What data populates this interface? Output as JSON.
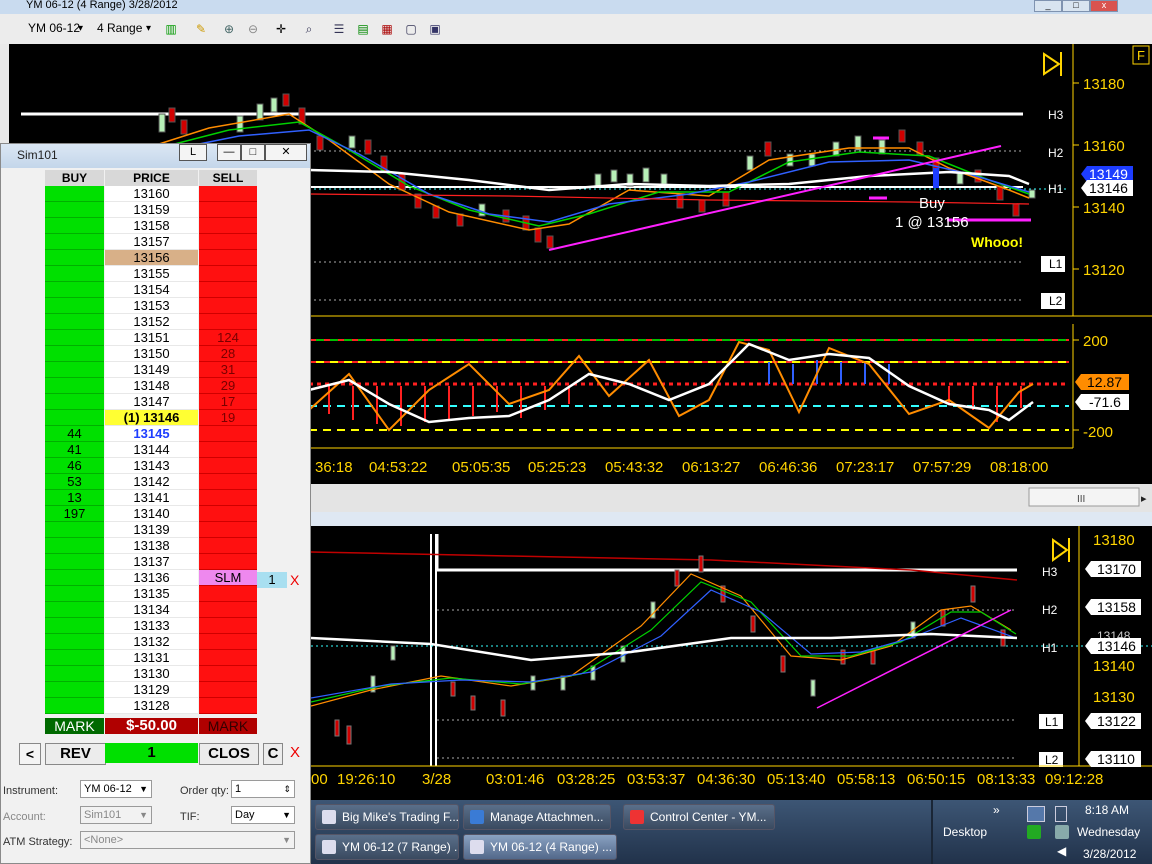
{
  "window": {
    "title": "YM 06-12 (4 Range)  3/28/2012"
  },
  "toolbar": {
    "instrument": "YM 06-12",
    "range": "4 Range"
  },
  "chart1": {
    "prices": [
      "13180",
      "13160",
      "13140",
      "13120"
    ],
    "tags": [
      "H3",
      "H2",
      "H1",
      "L1",
      "L2"
    ],
    "price_marker_a": "13149",
    "price_marker_b": "13146",
    "fill_text_1": "Buy",
    "fill_text_2": "1 @ 13156",
    "note": "Whooo!",
    "f_button": "F",
    "osc_values": [
      "200",
      "-200"
    ],
    "osc_marker_a": "12.87",
    "osc_marker_b": "-71.6",
    "times": [
      "36:18",
      "04:53:22",
      "05:05:35",
      "05:25:23",
      "05:43:32",
      "06:13:27",
      "06:46:36",
      "07:23:17",
      "07:57:29",
      "08:18:00"
    ],
    "scroll_grip": "III"
  },
  "chart2": {
    "prices": [
      "13180",
      "13140",
      "13130"
    ],
    "boxed_prices": [
      "13170",
      "13158",
      "13146",
      "13122",
      "13110"
    ],
    "hidden_price": "13148",
    "tags": [
      "H3",
      "H2",
      "H1",
      "L1",
      "L2"
    ],
    "times": [
      "00",
      "19:26:10",
      "3/28",
      "03:01:46",
      "03:28:25",
      "03:53:37",
      "04:36:30",
      "05:13:40",
      "05:58:13",
      "06:50:15",
      "08:13:33",
      "09:12:28"
    ]
  },
  "dom": {
    "title": "Sim101",
    "title_btn": "L",
    "headers": {
      "buy": "BUY",
      "price": "PRICE",
      "sell": "SELL"
    },
    "rows": [
      {
        "buy": "",
        "price": "13160",
        "sell": ""
      },
      {
        "buy": "",
        "price": "13159",
        "sell": ""
      },
      {
        "buy": "",
        "price": "13158",
        "sell": ""
      },
      {
        "buy": "",
        "price": "13157",
        "sell": ""
      },
      {
        "buy": "",
        "price": "13156",
        "sell": ""
      },
      {
        "buy": "",
        "price": "13155",
        "sell": ""
      },
      {
        "buy": "",
        "price": "13154",
        "sell": ""
      },
      {
        "buy": "",
        "price": "13153",
        "sell": ""
      },
      {
        "buy": "",
        "price": "13152",
        "sell": ""
      },
      {
        "buy": "",
        "price": "13151",
        "sell": "124"
      },
      {
        "buy": "",
        "price": "13150",
        "sell": "28"
      },
      {
        "buy": "",
        "price": "13149",
        "sell": "31"
      },
      {
        "buy": "",
        "price": "13148",
        "sell": "29"
      },
      {
        "buy": "",
        "price": "13147",
        "sell": "17"
      },
      {
        "buy": "",
        "price": "(1) 13146",
        "sell": "19"
      },
      {
        "buy": "44",
        "price": "13145",
        "sell": ""
      },
      {
        "buy": "41",
        "price": "13144",
        "sell": ""
      },
      {
        "buy": "46",
        "price": "13143",
        "sell": ""
      },
      {
        "buy": "53",
        "price": "13142",
        "sell": ""
      },
      {
        "buy": "13",
        "price": "13141",
        "sell": ""
      },
      {
        "buy": "197",
        "price": "13140",
        "sell": ""
      },
      {
        "buy": "",
        "price": "13139",
        "sell": ""
      },
      {
        "buy": "",
        "price": "13138",
        "sell": ""
      },
      {
        "buy": "",
        "price": "13137",
        "sell": ""
      },
      {
        "buy": "",
        "price": "13136",
        "sell": "SLM"
      },
      {
        "buy": "",
        "price": "13135",
        "sell": ""
      },
      {
        "buy": "",
        "price": "13134",
        "sell": ""
      },
      {
        "buy": "",
        "price": "13133",
        "sell": ""
      },
      {
        "buy": "",
        "price": "13132",
        "sell": ""
      },
      {
        "buy": "",
        "price": "13131",
        "sell": ""
      },
      {
        "buy": "",
        "price": "13130",
        "sell": ""
      },
      {
        "buy": "",
        "price": "13129",
        "sell": ""
      },
      {
        "buy": "",
        "price": "13128",
        "sell": ""
      }
    ],
    "slm_qty": "1",
    "slm_cancel": "X",
    "mark_left": "MARK",
    "pnl": "$-50.00",
    "mark_right": "MARK",
    "btn_prev": "<",
    "btn_rev": "REV",
    "qty_display": "1",
    "btn_close": "CLOS",
    "btn_c": "C",
    "btn_x": "X",
    "instrument_label": "Instrument:",
    "instrument_value": "YM 06-12",
    "orderqty_label": "Order qty:",
    "orderqty_value": "1",
    "account_label": "Account:",
    "account_value": "Sim101",
    "tif_label": "TIF:",
    "tif_value": "Day",
    "atm_label": "ATM Strategy:",
    "atm_value": "<None>"
  },
  "taskbar": {
    "items": [
      "Big Mike's Trading F...",
      "Manage Attachmen...",
      "Control Center - YM...",
      "YM 06-12 (7 Range) ...",
      "YM 06-12 (4 Range) ..."
    ],
    "desktop": "Desktop",
    "chevron": "»",
    "time": "8:18 AM",
    "day": "Wednesday",
    "date": "3/28/2012"
  },
  "colors": {
    "up": "#b8f0b8",
    "down": "#d00000",
    "trend": "#ff20ff",
    "axis": "#ffd400",
    "buy": "#00e000",
    "sell": "#ff1010"
  }
}
